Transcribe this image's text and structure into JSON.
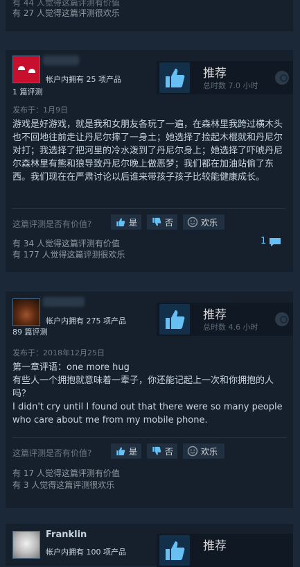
{
  "top_card": {
    "line1": "有 44 人觉得这篇评测有价值",
    "line2": "有 27 人觉得这篇评测很欢乐"
  },
  "reviews": [
    {
      "username": "",
      "products_owned": "帐户内拥有 25 项产品",
      "review_count": "1 篇评测",
      "recommendation": "推荐",
      "hours": "总时数 7.0 小时",
      "posted": "发布于：1月9日",
      "body": "游戏是好游戏，就是我和女朋友各玩了一遍，在森林里我跨过横木头也不回地往前走让丹尼尔摔了一身土；她选择了捡起木棍就和丹尼尔对打；我选择了把河里的冷水泼到了丹尼尔身上；她选择了吓唬丹尼尔森林里有熊和狼导致丹尼尔晚上做恶梦；我们都在加油站偷了东西。我们现在在严肃讨论以后谁来带孩子孩子比较能健康成长。",
      "helpful_prompt": "这篇评测是否有价值?",
      "yes_label": "是",
      "no_label": "否",
      "funny_label": "欢乐",
      "comment_count": "1",
      "helpful_count_text": "有 34 人觉得这篇评测有价值",
      "funny_count_text": "有 177 人觉得这篇评测很欢乐"
    },
    {
      "username": "",
      "products_owned": "帐户内拥有 275 项产品",
      "review_count": "89 篇评测",
      "recommendation": "推荐",
      "hours": "总时数 4.6 小时",
      "posted": "发布于：2018年12月25日",
      "body_lines": [
        "第一章评语：one more hug",
        "有些人一个拥抱就意味着一辈子，你还能记起上一次和你拥抱的人吗？",
        "I didn't cry until I found out that there were so many people who care about me from my mobile phone."
      ],
      "helpful_prompt": "这篇评测是否有价值?",
      "yes_label": "是",
      "no_label": "否",
      "funny_label": "欢乐",
      "helpful_count_text": "有 17 人觉得这篇评测有价值",
      "funny_count_text": "有 3 人觉得这篇评测很欢乐"
    },
    {
      "username": "Franklin",
      "products_owned": "帐户内拥有 100 项产品",
      "recommendation": "推荐"
    }
  ],
  "colors": {
    "background": "#1b2838",
    "card": "#16202d",
    "accent_blue": "#66c0f4",
    "text_light": "#c6d4df",
    "text_muted": "#8f98a0"
  }
}
